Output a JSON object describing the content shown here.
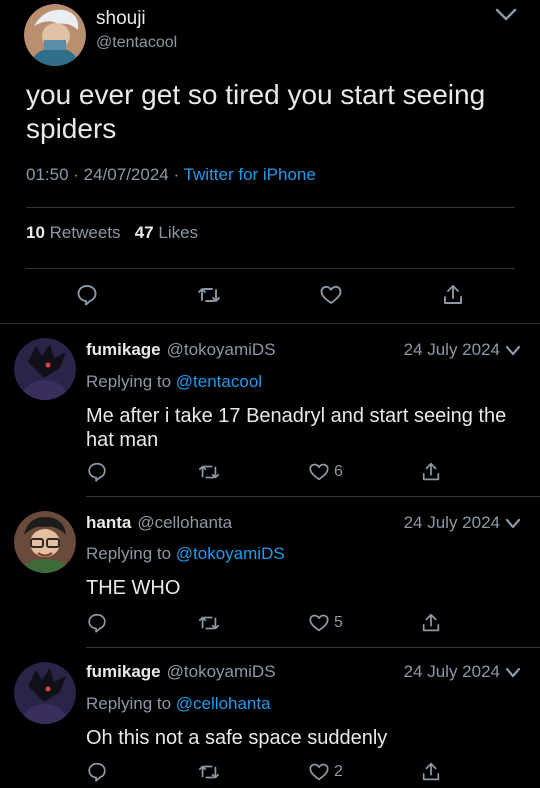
{
  "tweet": {
    "author_name": "shouji",
    "author_handle": "@tentacool",
    "text": "you ever get so tired you start seeing spiders",
    "time": "01:50",
    "sep1": " · ",
    "date": "24/07/2024",
    "sep2": " · ",
    "source": "Twitter for iPhone",
    "retweets_count": "10",
    "retweets_label": "Retweets",
    "likes_count": "47",
    "likes_label": "Likes"
  },
  "replies": [
    {
      "name": "fumikage",
      "handle": "@tokoyamiDS",
      "date": "24 July 2024",
      "replying_label": "Replying to",
      "replying_to": "@tentacool",
      "text": "Me after i take 17 Benadryl and start seeing the hat man",
      "likes": "6"
    },
    {
      "name": "hanta",
      "handle": "@cellohanta",
      "date": "24 July 2024",
      "replying_label": "Replying to",
      "replying_to": "@tokoyamiDS",
      "text": "THE WHO",
      "likes": "5"
    },
    {
      "name": "fumikage",
      "handle": "@tokoyamiDS",
      "date": "24 July 2024",
      "replying_label": "Replying to",
      "replying_to": "@cellohanta",
      "text": "Oh this not a safe space suddenly",
      "likes": "2"
    }
  ],
  "colors": {
    "background": "#000000",
    "text": "#e7e9ea",
    "secondary": "#8b98a5",
    "link": "#1d9bf0",
    "divider": "#2f3336"
  }
}
